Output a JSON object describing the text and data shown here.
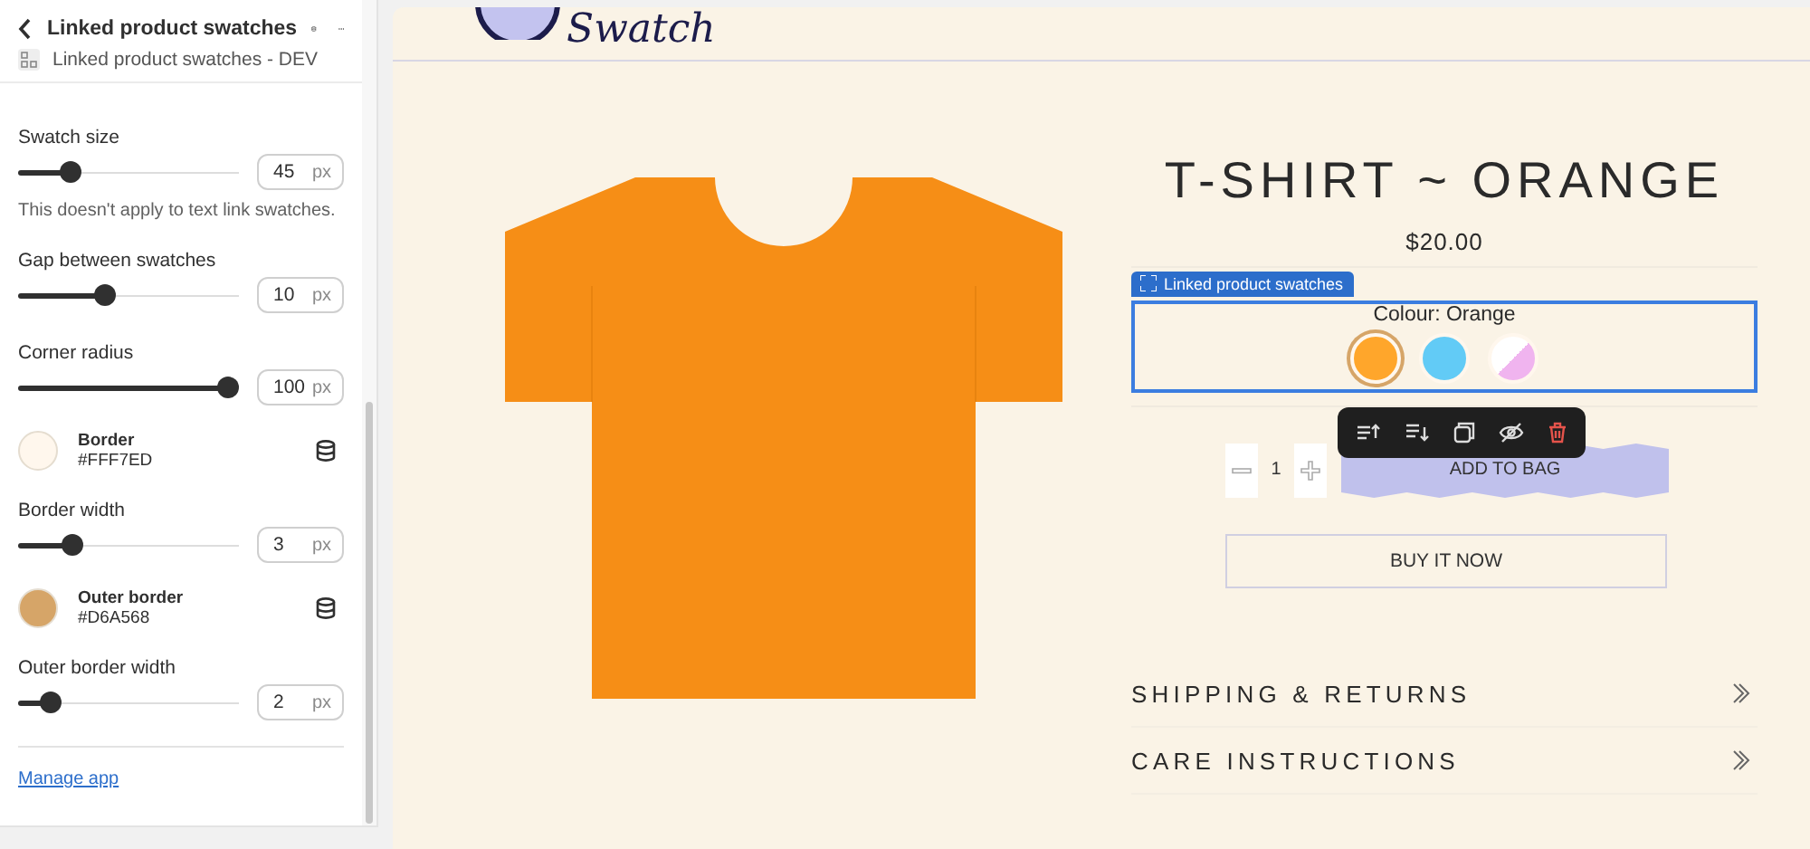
{
  "sidebar": {
    "header": {
      "title": "Linked product swatches",
      "subtitle": "Linked product swatches - DEV"
    },
    "settings": [
      {
        "kind": "slider",
        "label": "Swatch size",
        "level": 0.21,
        "value": "45",
        "unit": "px",
        "help": "This doesn't apply to text link swatches."
      },
      {
        "kind": "slider",
        "label": "Gap between swatches",
        "level": 0.38,
        "value": "10",
        "unit": "px"
      },
      {
        "kind": "slider",
        "label": "Corner radius",
        "level": 1,
        "value": "100",
        "unit": "px"
      },
      {
        "kind": "color",
        "label": "Border",
        "value": "#FFF7ED",
        "color": "#fff7ed"
      },
      {
        "kind": "slider",
        "label": "Border width",
        "level": 0.22,
        "value": "3",
        "unit": "px"
      },
      {
        "kind": "color",
        "label": "Outer border",
        "value": "#D6A568",
        "color": "#d6a568"
      },
      {
        "kind": "slider",
        "label": "Outer border width",
        "level": 0.11,
        "value": "2",
        "unit": "px"
      }
    ],
    "footer_link": "Manage app"
  },
  "preview": {
    "logo": "Swatch",
    "product": {
      "title": "T-SHIRT ~ ORANGE",
      "price": "$20.00",
      "block_label": "Linked product swatches",
      "option_label": "Colour: Orange",
      "swatches": [
        {
          "kind": "solid",
          "color": "#ffa62b",
          "selected": true
        },
        {
          "kind": "solid",
          "color": "#62cbf6",
          "selected": false
        },
        {
          "kind": "split",
          "color": "#f0b4ef",
          "selected": false
        }
      ],
      "quantity": "1",
      "add_button": "ADD TO BAG",
      "buy_button": "BUY IT NOW",
      "accordions": [
        {
          "label": "SHIPPING & RETURNS",
          "expanded": false
        },
        {
          "label": "CARE INSTRUCTIONS",
          "expanded": false
        }
      ]
    }
  }
}
